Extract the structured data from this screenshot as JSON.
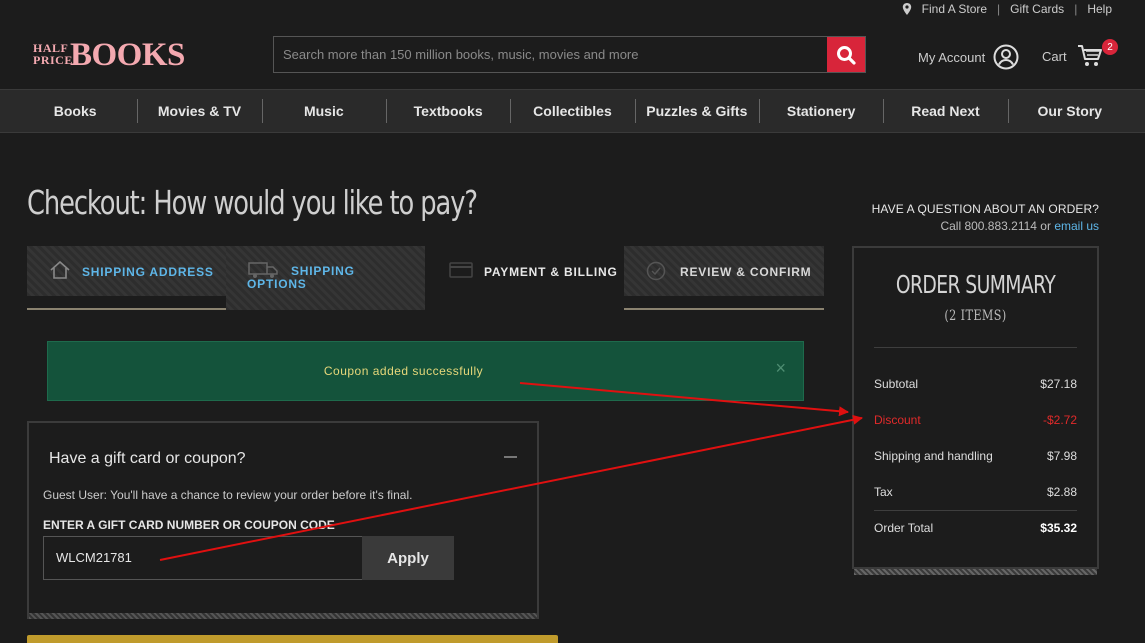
{
  "util": {
    "find_store": "Find A Store",
    "gift_cards": "Gift Cards",
    "help": "Help",
    "sep": "|"
  },
  "logo": {
    "small_line1": "HALF",
    "small_line2": "PRICE",
    "big": "BOOKS"
  },
  "search": {
    "placeholder": "Search more than 150 million books, music, movies and more"
  },
  "account": {
    "label": "My Account"
  },
  "cart": {
    "label": "Cart",
    "count": "2"
  },
  "nav": [
    "Books",
    "Movies & TV",
    "Music",
    "Textbooks",
    "Collectibles",
    "Puzzles & Gifts",
    "Stationery",
    "Read Next",
    "Our Story"
  ],
  "page": {
    "title": "Checkout: How would you like to pay?"
  },
  "steps": {
    "shipping_address": "SHIPPING ADDRESS",
    "shipping_options": "SHIPPING OPTIONS",
    "payment_billing": "PAYMENT & BILLING",
    "review_confirm": "REVIEW & CONFIRM"
  },
  "alert": {
    "message": "Coupon added successfully",
    "close": "×"
  },
  "coupon": {
    "heading": "Have a gift card or coupon?",
    "guest_note": "Guest User: You'll have a chance to review your order before it's final.",
    "field_label": "ENTER A GIFT CARD NUMBER OR COUPON CODE",
    "value": "WLCM21781",
    "apply": "Apply"
  },
  "help": {
    "question": "HAVE A QUESTION ABOUT AN ORDER?",
    "call_prefix": "Call 800.883.2114 or",
    "email": "email us"
  },
  "summary": {
    "title": "ORDER SUMMARY",
    "count": "(2 ITEMS)",
    "subtotal_label": "Subtotal",
    "subtotal": "$27.18",
    "discount_label": "Discount",
    "discount": "-$2.72",
    "shipping_label": "Shipping and handling",
    "shipping": "$7.98",
    "tax_label": "Tax",
    "tax": "$2.88",
    "total_label": "Order Total",
    "total": "$35.32"
  },
  "colors": {
    "accent_red": "#d8253a",
    "link_blue": "#5eb6e8",
    "success_green": "#14533b",
    "annotation_red": "#e01010"
  }
}
